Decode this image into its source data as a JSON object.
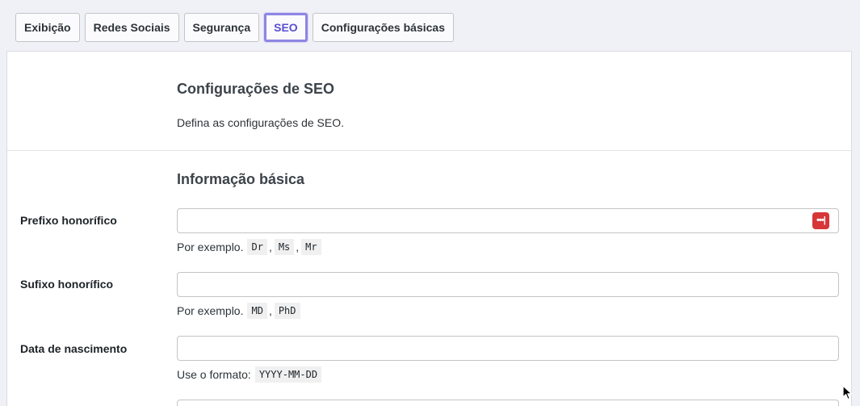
{
  "tabs": [
    {
      "label": "Exibição",
      "active": false
    },
    {
      "label": "Redes Sociais",
      "active": false
    },
    {
      "label": "Segurança",
      "active": false
    },
    {
      "label": "SEO",
      "active": true
    },
    {
      "label": "Configurações básicas",
      "active": false
    }
  ],
  "header": {
    "title": "Configurações de SEO",
    "description": "Defina as configurações de SEO."
  },
  "section": {
    "title": "Informação básica"
  },
  "fields": {
    "prefix": {
      "label": "Prefixo honorífico",
      "value": "",
      "hint_text": "Por exemplo.",
      "examples": [
        "Dr",
        "Ms",
        "Mr"
      ],
      "icon": "password-manager-icon"
    },
    "suffix": {
      "label": "Sufixo honorífico",
      "value": "",
      "hint_text": "Por exemplo.",
      "examples": [
        "MD",
        "PhD"
      ]
    },
    "birthdate": {
      "label": "Data de nascimento",
      "value": "",
      "hint_text": "Use o formato:",
      "format": "YYYY-MM-DD"
    }
  },
  "colors": {
    "accent": "#5a4fcf",
    "icon_red": "#d63638"
  }
}
